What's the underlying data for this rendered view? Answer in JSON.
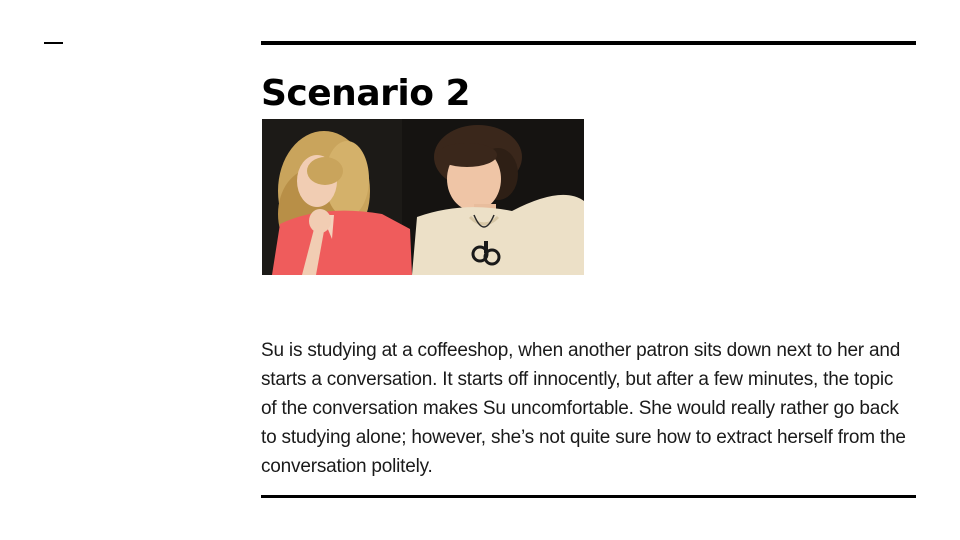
{
  "slide": {
    "title": "Scenario 2",
    "body": "Su is studying at a coffeeshop, when another patron sits down next to her and starts a conversation. It starts off innocently, but after a few minutes, the topic of the conversation makes Su uncomfortable. She would really rather go back to studying alone; however, she’s not quite sure how to extract herself from the conversation politely."
  },
  "colors": {
    "background": "#ffffff",
    "rules": "#000000",
    "text": "#1a1a1a"
  }
}
